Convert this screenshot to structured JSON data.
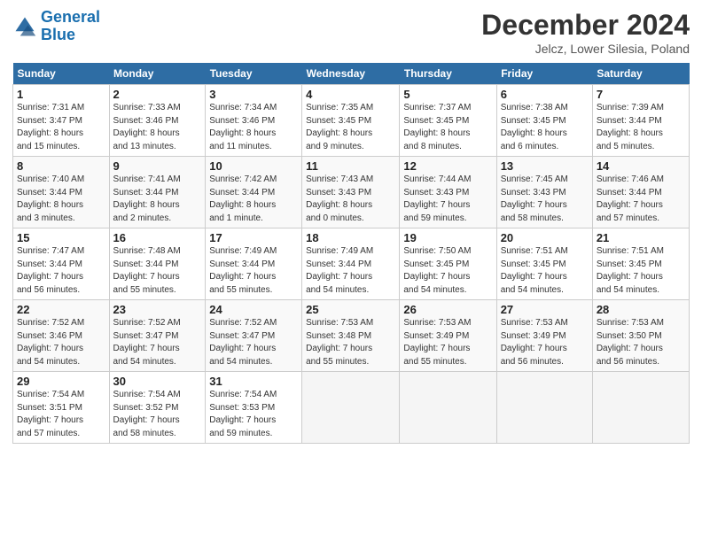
{
  "header": {
    "logo_line1": "General",
    "logo_line2": "Blue",
    "month": "December 2024",
    "location": "Jelcz, Lower Silesia, Poland"
  },
  "weekdays": [
    "Sunday",
    "Monday",
    "Tuesday",
    "Wednesday",
    "Thursday",
    "Friday",
    "Saturday"
  ],
  "weeks": [
    [
      {
        "day": "1",
        "info": "Sunrise: 7:31 AM\nSunset: 3:47 PM\nDaylight: 8 hours\nand 15 minutes."
      },
      {
        "day": "2",
        "info": "Sunrise: 7:33 AM\nSunset: 3:46 PM\nDaylight: 8 hours\nand 13 minutes."
      },
      {
        "day": "3",
        "info": "Sunrise: 7:34 AM\nSunset: 3:46 PM\nDaylight: 8 hours\nand 11 minutes."
      },
      {
        "day": "4",
        "info": "Sunrise: 7:35 AM\nSunset: 3:45 PM\nDaylight: 8 hours\nand 9 minutes."
      },
      {
        "day": "5",
        "info": "Sunrise: 7:37 AM\nSunset: 3:45 PM\nDaylight: 8 hours\nand 8 minutes."
      },
      {
        "day": "6",
        "info": "Sunrise: 7:38 AM\nSunset: 3:45 PM\nDaylight: 8 hours\nand 6 minutes."
      },
      {
        "day": "7",
        "info": "Sunrise: 7:39 AM\nSunset: 3:44 PM\nDaylight: 8 hours\nand 5 minutes."
      }
    ],
    [
      {
        "day": "8",
        "info": "Sunrise: 7:40 AM\nSunset: 3:44 PM\nDaylight: 8 hours\nand 3 minutes."
      },
      {
        "day": "9",
        "info": "Sunrise: 7:41 AM\nSunset: 3:44 PM\nDaylight: 8 hours\nand 2 minutes."
      },
      {
        "day": "10",
        "info": "Sunrise: 7:42 AM\nSunset: 3:44 PM\nDaylight: 8 hours\nand 1 minute."
      },
      {
        "day": "11",
        "info": "Sunrise: 7:43 AM\nSunset: 3:43 PM\nDaylight: 8 hours\nand 0 minutes."
      },
      {
        "day": "12",
        "info": "Sunrise: 7:44 AM\nSunset: 3:43 PM\nDaylight: 7 hours\nand 59 minutes."
      },
      {
        "day": "13",
        "info": "Sunrise: 7:45 AM\nSunset: 3:43 PM\nDaylight: 7 hours\nand 58 minutes."
      },
      {
        "day": "14",
        "info": "Sunrise: 7:46 AM\nSunset: 3:44 PM\nDaylight: 7 hours\nand 57 minutes."
      }
    ],
    [
      {
        "day": "15",
        "info": "Sunrise: 7:47 AM\nSunset: 3:44 PM\nDaylight: 7 hours\nand 56 minutes."
      },
      {
        "day": "16",
        "info": "Sunrise: 7:48 AM\nSunset: 3:44 PM\nDaylight: 7 hours\nand 55 minutes."
      },
      {
        "day": "17",
        "info": "Sunrise: 7:49 AM\nSunset: 3:44 PM\nDaylight: 7 hours\nand 55 minutes."
      },
      {
        "day": "18",
        "info": "Sunrise: 7:49 AM\nSunset: 3:44 PM\nDaylight: 7 hours\nand 54 minutes."
      },
      {
        "day": "19",
        "info": "Sunrise: 7:50 AM\nSunset: 3:45 PM\nDaylight: 7 hours\nand 54 minutes."
      },
      {
        "day": "20",
        "info": "Sunrise: 7:51 AM\nSunset: 3:45 PM\nDaylight: 7 hours\nand 54 minutes."
      },
      {
        "day": "21",
        "info": "Sunrise: 7:51 AM\nSunset: 3:45 PM\nDaylight: 7 hours\nand 54 minutes."
      }
    ],
    [
      {
        "day": "22",
        "info": "Sunrise: 7:52 AM\nSunset: 3:46 PM\nDaylight: 7 hours\nand 54 minutes."
      },
      {
        "day": "23",
        "info": "Sunrise: 7:52 AM\nSunset: 3:47 PM\nDaylight: 7 hours\nand 54 minutes."
      },
      {
        "day": "24",
        "info": "Sunrise: 7:52 AM\nSunset: 3:47 PM\nDaylight: 7 hours\nand 54 minutes."
      },
      {
        "day": "25",
        "info": "Sunrise: 7:53 AM\nSunset: 3:48 PM\nDaylight: 7 hours\nand 55 minutes."
      },
      {
        "day": "26",
        "info": "Sunrise: 7:53 AM\nSunset: 3:49 PM\nDaylight: 7 hours\nand 55 minutes."
      },
      {
        "day": "27",
        "info": "Sunrise: 7:53 AM\nSunset: 3:49 PM\nDaylight: 7 hours\nand 56 minutes."
      },
      {
        "day": "28",
        "info": "Sunrise: 7:53 AM\nSunset: 3:50 PM\nDaylight: 7 hours\nand 56 minutes."
      }
    ],
    [
      {
        "day": "29",
        "info": "Sunrise: 7:54 AM\nSunset: 3:51 PM\nDaylight: 7 hours\nand 57 minutes."
      },
      {
        "day": "30",
        "info": "Sunrise: 7:54 AM\nSunset: 3:52 PM\nDaylight: 7 hours\nand 58 minutes."
      },
      {
        "day": "31",
        "info": "Sunrise: 7:54 AM\nSunset: 3:53 PM\nDaylight: 7 hours\nand 59 minutes."
      },
      null,
      null,
      null,
      null
    ]
  ]
}
